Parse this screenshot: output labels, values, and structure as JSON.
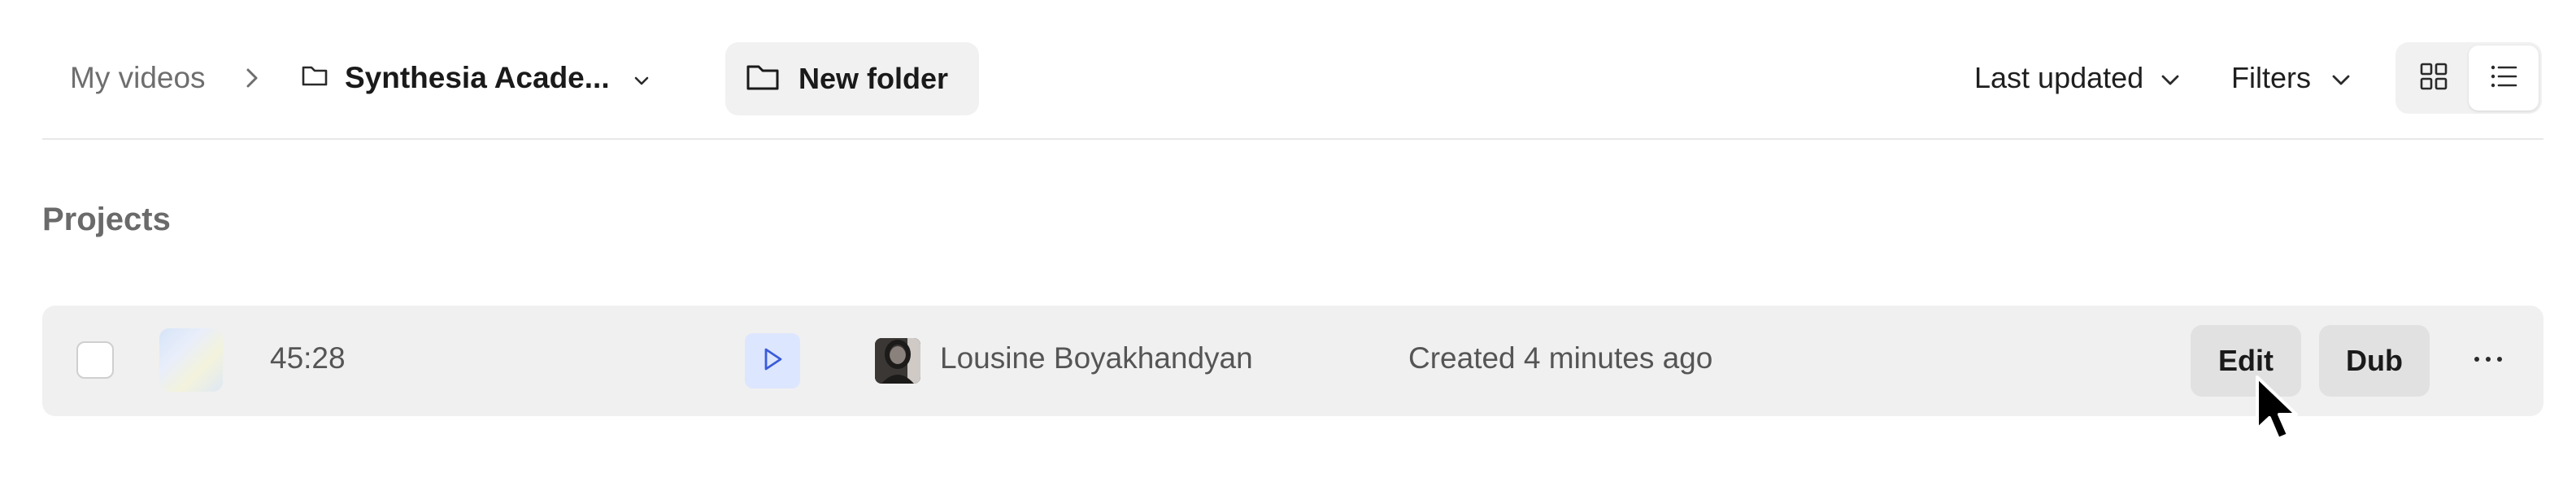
{
  "breadcrumb": {
    "root": "My videos",
    "separator": "›",
    "folder": "Synthesia Acade..."
  },
  "toolbar": {
    "new_folder_label": "New folder",
    "sort_label": "Last updated",
    "filters_label": "Filters",
    "view_mode": "list"
  },
  "section": {
    "title": "Projects"
  },
  "projects": [
    {
      "duration": "45:28",
      "owner": "Lousine Boyakhandyan",
      "created": "Created 4 minutes ago",
      "edit_label": "Edit",
      "dub_label": "Dub"
    }
  ],
  "colors": {
    "row_background": "#f0f0f0",
    "button_background": "#e1e1e1",
    "play_background": "#dde6ff",
    "play_icon": "#3b5bdb",
    "divider": "#e8e8e8"
  },
  "icons": [
    "chevron-right-icon",
    "folder-icon",
    "chevron-down-icon",
    "grid-view-icon",
    "list-view-icon",
    "play-icon",
    "more-horizontal-icon",
    "mouse-cursor-icon"
  ]
}
